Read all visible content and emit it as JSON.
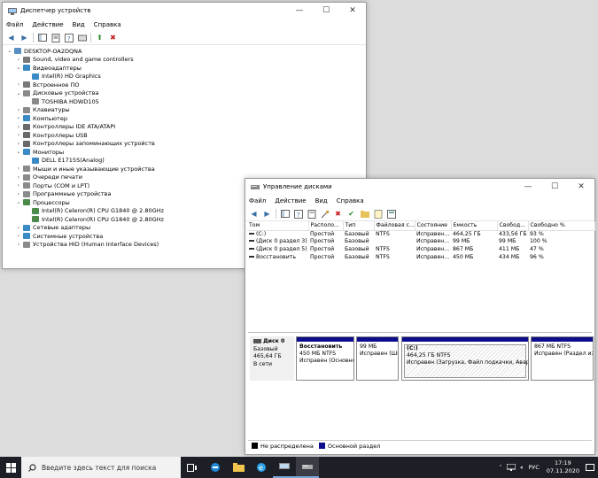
{
  "device_manager": {
    "title": "Диспетчер устройств",
    "menu": [
      "Файл",
      "Действие",
      "Вид",
      "Справка"
    ],
    "tree": [
      {
        "text": "DESKTOP-OA2DQNA",
        "level": 0,
        "arrow": "v",
        "color": "#5a8fc4"
      },
      {
        "text": "Sound, video and game controllers",
        "level": 1,
        "arrow": ">",
        "color": "#7a7a7a"
      },
      {
        "text": "Видеоадаптеры",
        "level": 1,
        "arrow": "v",
        "color": "#3a8ac6"
      },
      {
        "text": "Intel(R) HD Graphics",
        "level": 2,
        "arrow": "",
        "color": "#3a8ac6"
      },
      {
        "text": "Встроенное ПО",
        "level": 1,
        "arrow": ">",
        "color": "#7a7a7a"
      },
      {
        "text": "Дисковые устройства",
        "level": 1,
        "arrow": "v",
        "color": "#8a8a8a"
      },
      {
        "text": "TOSHIBA HDWD105",
        "level": 2,
        "arrow": "",
        "color": "#8a8a8a"
      },
      {
        "text": "Клавиатуры",
        "level": 1,
        "arrow": ">",
        "color": "#8a8a8a"
      },
      {
        "text": "Компьютер",
        "level": 1,
        "arrow": ">",
        "color": "#3a8ac6"
      },
      {
        "text": "Контроллеры IDE ATA/ATAPI",
        "level": 1,
        "arrow": ">",
        "color": "#6a6a6a"
      },
      {
        "text": "Контроллеры USB",
        "level": 1,
        "arrow": ">",
        "color": "#6a6a6a"
      },
      {
        "text": "Контроллеры запоминающих устройств",
        "level": 1,
        "arrow": ">",
        "color": "#6a6a6a"
      },
      {
        "text": "Мониторы",
        "level": 1,
        "arrow": "v",
        "color": "#3a8ac6"
      },
      {
        "text": "DELL E1715S(Analog)",
        "level": 2,
        "arrow": "",
        "color": "#3a8ac6"
      },
      {
        "text": "Мыши и иные указывающие устройства",
        "level": 1,
        "arrow": ">",
        "color": "#8a8a8a"
      },
      {
        "text": "Очереди печати",
        "level": 1,
        "arrow": ">",
        "color": "#8a8a8a"
      },
      {
        "text": "Порты (COM и LPT)",
        "level": 1,
        "arrow": ">",
        "color": "#8a8a8a"
      },
      {
        "text": "Программные устройства",
        "level": 1,
        "arrow": ">",
        "color": "#8a8a8a"
      },
      {
        "text": "Процессоры",
        "level": 1,
        "arrow": "v",
        "color": "#4c8a4c"
      },
      {
        "text": "Intel(R) Celeron(R) CPU G1840 @ 2.80GHz",
        "level": 2,
        "arrow": "",
        "color": "#4c8a4c"
      },
      {
        "text": "Intel(R) Celeron(R) CPU G1840 @ 2.80GHz",
        "level": 2,
        "arrow": "",
        "color": "#4c8a4c"
      },
      {
        "text": "Сетевые адаптеры",
        "level": 1,
        "arrow": ">",
        "color": "#3a8ac6"
      },
      {
        "text": "Системные устройства",
        "level": 1,
        "arrow": ">",
        "color": "#3a8ac6"
      },
      {
        "text": "Устройства HID (Human Interface Devices)",
        "level": 1,
        "arrow": ">",
        "color": "#8a8a8a"
      }
    ]
  },
  "disk_management": {
    "title": "Управление дисками",
    "menu": [
      "Файл",
      "Действие",
      "Вид",
      "Справка"
    ],
    "columns": [
      "Том",
      "Располо...",
      "Тип",
      "Файловая с...",
      "Состояние",
      "Емкость",
      "Свобод...",
      "Свободно %"
    ],
    "rows": [
      [
        "(C:)",
        "Простой",
        "Базовый",
        "NTFS",
        "Исправен...",
        "464,25 ГБ",
        "433,56 ГБ",
        "93 %"
      ],
      [
        "(Диск 0 раздел 3)",
        "Простой",
        "Базовый",
        "",
        "Исправен...",
        "99 МБ",
        "99 МБ",
        "100 %"
      ],
      [
        "(Диск 0 раздел 5)",
        "Простой",
        "Базовый",
        "NTFS",
        "Исправен...",
        "867 МБ",
        "411 МБ",
        "47 %"
      ],
      [
        "Восстановить",
        "Простой",
        "Базовый",
        "NTFS",
        "Исправен...",
        "450 МБ",
        "434 МБ",
        "96 %"
      ]
    ],
    "disk": {
      "name": "Диск 0",
      "type": "Базовый",
      "size": "465,64 ГБ",
      "status": "В сети"
    },
    "partitions": [
      {
        "name": "Восстановить",
        "size": "450 МБ NTFS",
        "status": "Исправен (Основно"
      },
      {
        "name": "",
        "size": "99 МБ",
        "status": "Исправен (Ши"
      },
      {
        "name": "(C:)",
        "size": "464,25 ГБ NTFS",
        "status": "Исправен (Загрузка, Файл подкачки, Аварийны"
      },
      {
        "name": "",
        "size": "867 МБ NTFS",
        "status": "Исправен (Раздел изгот"
      }
    ],
    "legend": [
      {
        "label": "Не распределена",
        "color": "#000000"
      },
      {
        "label": "Основной раздел",
        "color": "#0c0c8c"
      }
    ]
  },
  "taskbar": {
    "search_placeholder": "Введите здесь текст для поиска",
    "lang": "РУС",
    "time": "17:19",
    "date": "07.11.2020"
  }
}
